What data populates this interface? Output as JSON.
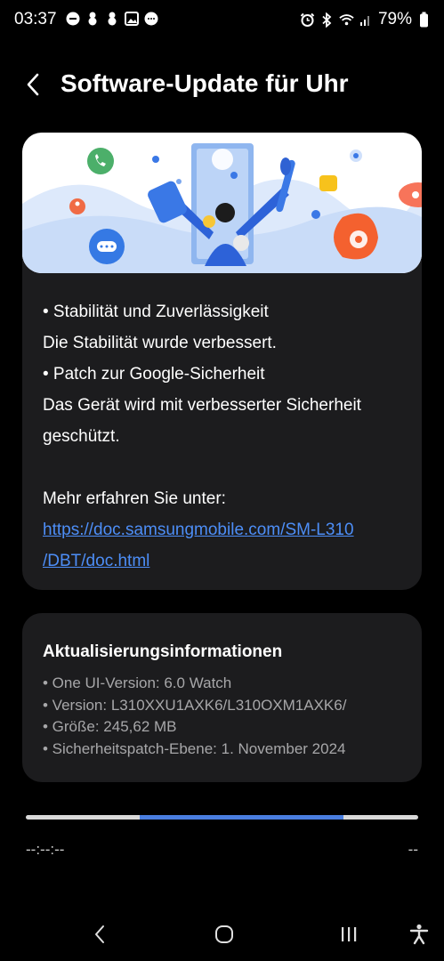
{
  "status_bar": {
    "time": "03:37",
    "battery": "79%"
  },
  "header": {
    "title": "Software-Update für Uhr"
  },
  "release_notes": {
    "lines": [
      "• Stabilität und Zuverlässigkeit",
      "Die Stabilität wurde verbessert.",
      "• Patch zur Google-Sicherheit",
      "Das Gerät wird mit verbesserter Sicherheit",
      "geschützt."
    ],
    "more_info_label": "Mehr erfahren Sie unter:",
    "link_line_1": "https://doc.samsungmobile.com/SM-L310",
    "link_line_2": "/DBT/doc.html"
  },
  "update_info": {
    "title": "Aktualisierungsinformationen",
    "items": [
      "• One UI-Version: 6.0 Watch",
      "• Version: L310XXU1AXK6/L310OXM1AXK6/",
      "• Größe: 245,62 MB",
      "• Sicherheitspatch-Ebene: 1. November 2024"
    ]
  },
  "progress": {
    "indeterminate_segment_start": 0.29,
    "indeterminate_segment_end": 0.81,
    "elapsed": "--:--:--",
    "remaining": "--"
  },
  "icons": {
    "back": "chevron-left-icon",
    "nav_back": "nav-back-icon",
    "nav_home": "nav-home-icon",
    "nav_recents": "nav-recents-icon",
    "accessibility": "accessibility-icon"
  },
  "colors": {
    "accent": "#4a7ee0",
    "link": "#4d8ef7",
    "card": "#1c1c1e",
    "secondary_text": "#a7a7a9"
  }
}
